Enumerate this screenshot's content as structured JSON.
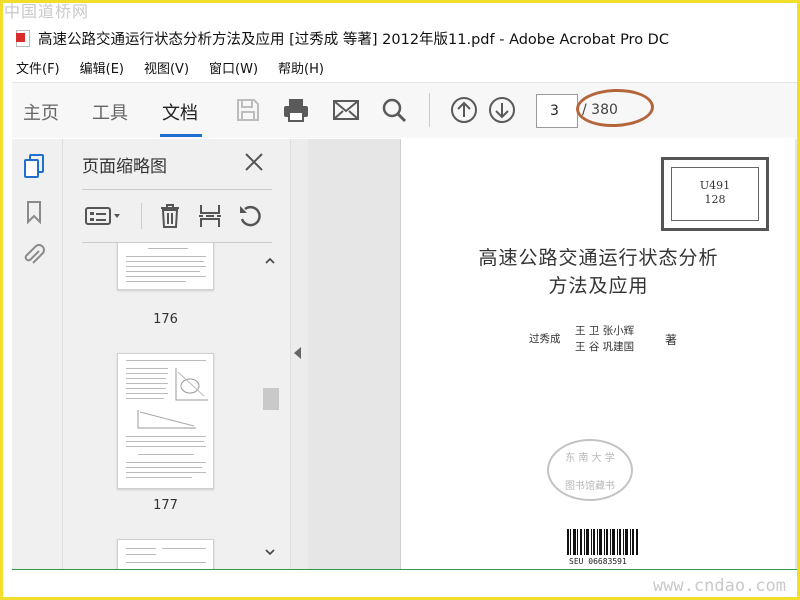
{
  "watermark": {
    "site_cn": "中国道桥网",
    "site_url": "www.cndao.com"
  },
  "window": {
    "title": "高速公路交通运行状态分析方法及应用 [过秀成 等著] 2012年版11.pdf - Adobe Acrobat Pro DC"
  },
  "menu": {
    "items": [
      {
        "label": "文件(F)"
      },
      {
        "label": "编辑(E)"
      },
      {
        "label": "视图(V)"
      },
      {
        "label": "窗口(W)"
      },
      {
        "label": "帮助(H)"
      }
    ]
  },
  "toolbar": {
    "tabs": [
      {
        "label": "主页"
      },
      {
        "label": "工具"
      },
      {
        "label": "文档"
      }
    ],
    "active_tab": "文档",
    "icons": [
      "save-icon",
      "print-icon",
      "email-icon",
      "search-icon",
      "page-up-icon",
      "page-down-icon"
    ],
    "page": {
      "current": "3",
      "total": "/ 380"
    }
  },
  "nav_rail": {
    "icons": [
      "page-thumbnails-icon",
      "bookmark-icon",
      "attachment-icon"
    ]
  },
  "thumbnail_panel": {
    "title": "页面缩略图",
    "tools": [
      "thumbnail-options-icon",
      "delete-page-icon",
      "insert-page-icon",
      "rotate-page-icon"
    ],
    "thumbnails": [
      {
        "label": "176"
      },
      {
        "label": "177"
      }
    ]
  },
  "document": {
    "stamp": {
      "line1": "U491",
      "line2": "128"
    },
    "title_line1": "高速公路交通运行状态分析",
    "title_line2": "方法及应用",
    "authors": {
      "first": "过秀成",
      "row1": "王   卫    张小辉",
      "row2": "王   谷    巩建国",
      "role": "著"
    },
    "seal": {
      "text_top": "东 南 大 学",
      "text_bottom": "图书馆藏书"
    },
    "barcode_text": "SEU    06683591"
  },
  "colors": {
    "accent": "#1f6fd0",
    "annotation": "#b5653c",
    "frame": "#f0de2a"
  }
}
